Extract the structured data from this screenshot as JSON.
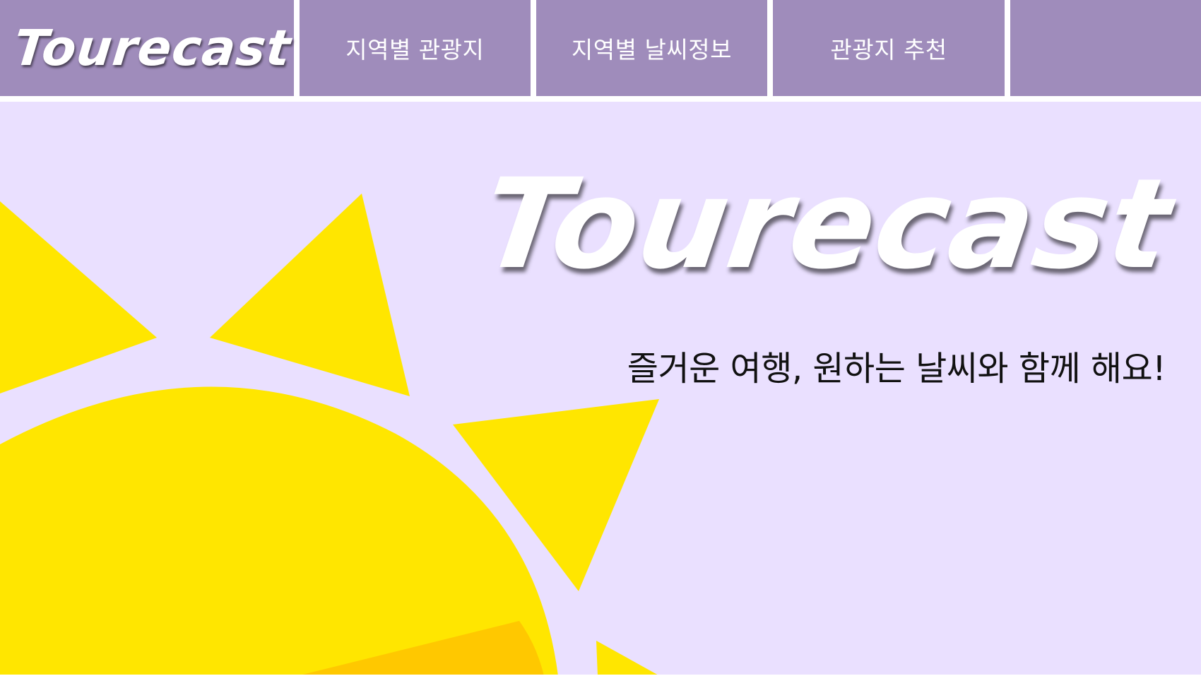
{
  "nav": {
    "logo": "Tourecast",
    "items": [
      {
        "label": "지역별 관광지"
      },
      {
        "label": "지역별 날씨정보"
      },
      {
        "label": "관광지 추천"
      }
    ]
  },
  "hero": {
    "logo": "Tourecast",
    "tagline": "즐거운 여행, 원하는 날씨와 함께 해요!"
  },
  "colors": {
    "nav_bg": "#9f8cbb",
    "hero_bg": "#eae0ff",
    "sun_yellow": "#ffe600",
    "sun_orange": "#ffc800"
  },
  "icons": {
    "hero_art": "sun-icon"
  }
}
